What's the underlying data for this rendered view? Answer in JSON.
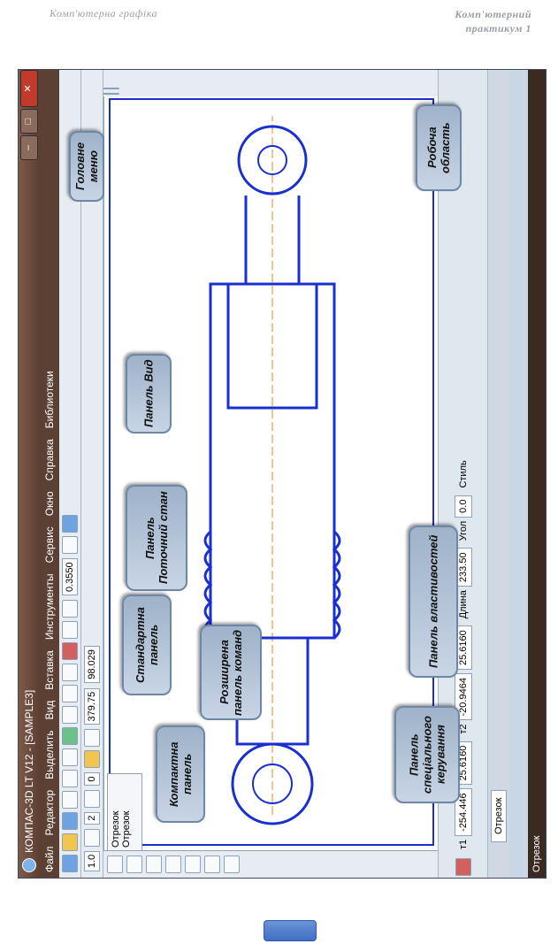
{
  "page_header": {
    "left": "Комп'ютерна графіка",
    "right_line1": "Комп'ютерний",
    "right_line2": "практикум 1"
  },
  "window": {
    "title": "КОМПАС-3D LT V12 - [SAMPLE3]",
    "controls": {
      "minimize": "–",
      "maximize": "□",
      "close": "✕"
    },
    "menu": [
      "Файл",
      "Редактор",
      "Выделить",
      "Вид",
      "Вставка",
      "Инструменты",
      "Сервис",
      "Окно",
      "Справка",
      "Библиотеки"
    ],
    "toolbar": {
      "line_style": "1.0",
      "layer": "2",
      "step": "0",
      "scale": "0.3550",
      "coord_x": "379.75",
      "coord_y": "98.029"
    },
    "popup": {
      "title": "Отрезок",
      "item": "Отрезок"
    },
    "properties": {
      "p1_label": "т1",
      "p1_x": "-254.446",
      "p1_y": "25.6160",
      "p2_label": "т2",
      "p2_x": "-20.9464",
      "p2_y": "25.6160",
      "length_label": "Длина",
      "length": "233.50",
      "angle_label": "Угол",
      "angle": "0.0",
      "style_label": "Стиль"
    },
    "tab": "Отрезок",
    "status": "Отрезок"
  },
  "callouts": {
    "main_menu": "Головне меню",
    "work_area": "Робоча область",
    "view_panel": "Панель Вид",
    "current_state": "Панель Поточний стан",
    "standard_panel": "Стандартна панель",
    "extended_panel": "Розширена панель команд",
    "compact_panel": "Компактна панель",
    "properties_panel": "Панель властивостей",
    "special_panel": "Панель спеціального керування"
  },
  "colors": {
    "drawing": "#1a2fd0",
    "callout_bg": "#b7c7da",
    "titlebar": "#6b4a3c"
  }
}
